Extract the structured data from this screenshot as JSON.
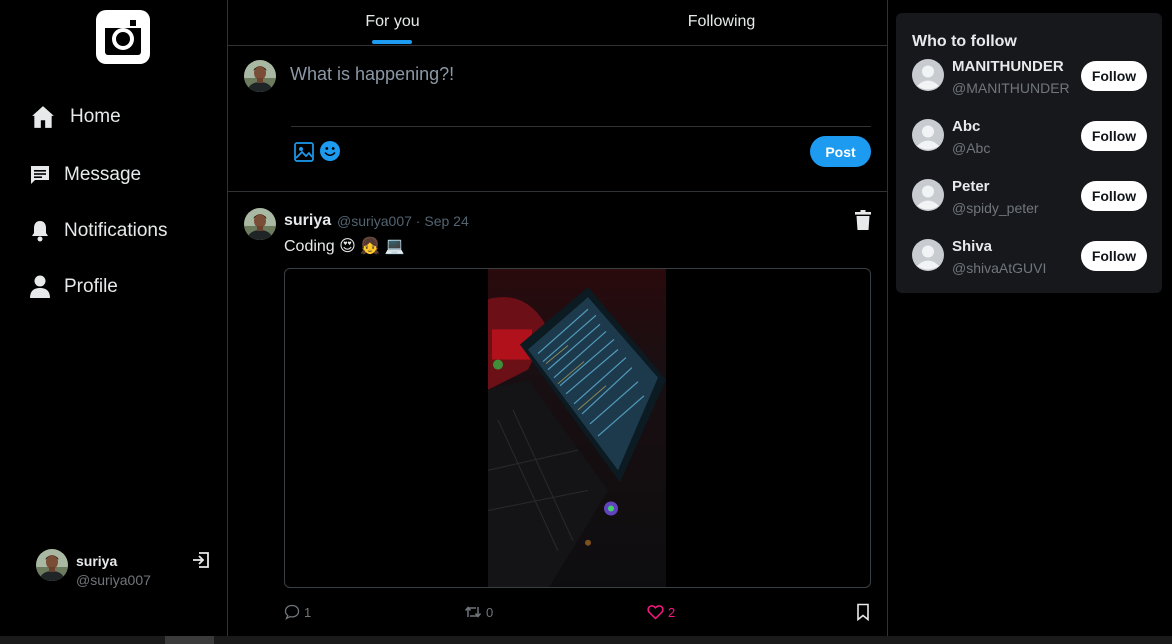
{
  "colors": {
    "accent": "#1d9bf0",
    "like": "#f91880",
    "background": "#000000",
    "panel": "#16181c",
    "border": "#2f3336",
    "muted_text": "#71767b"
  },
  "sidebar": {
    "logo_icon": "camera-logo-icon",
    "items": [
      {
        "label": "Home",
        "icon": "home-icon"
      },
      {
        "label": "Message",
        "icon": "message-icon"
      },
      {
        "label": "Notifications",
        "icon": "bell-icon"
      },
      {
        "label": "Profile",
        "icon": "user-icon"
      }
    ],
    "current_user": {
      "name": "suriya",
      "handle": "@suriya007"
    },
    "logout_icon": "logout-icon"
  },
  "tabs": [
    {
      "label": "For you",
      "active": true
    },
    {
      "label": "Following",
      "active": false
    }
  ],
  "compose": {
    "placeholder": "What is happening?!",
    "value": "",
    "post_label": "Post"
  },
  "post": {
    "author_name": "suriya",
    "meta": "@suriya007 · Sep 24",
    "text": "Coding 😍 👧 💻",
    "image_icon": "photo-laptop-image",
    "replies": "1",
    "retweets": "0",
    "likes": "2",
    "liked": true
  },
  "who_to_follow": {
    "title": "Who to follow",
    "users": [
      {
        "name": "MANITHUNDER",
        "handle": "@MANITHUNDER",
        "button": "Follow"
      },
      {
        "name": "Abc",
        "handle": "@Abc",
        "button": "Follow"
      },
      {
        "name": "Peter",
        "handle": "@spidy_peter",
        "button": "Follow"
      },
      {
        "name": "Shiva",
        "handle": "@shivaAtGUVI",
        "button": "Follow"
      }
    ]
  }
}
